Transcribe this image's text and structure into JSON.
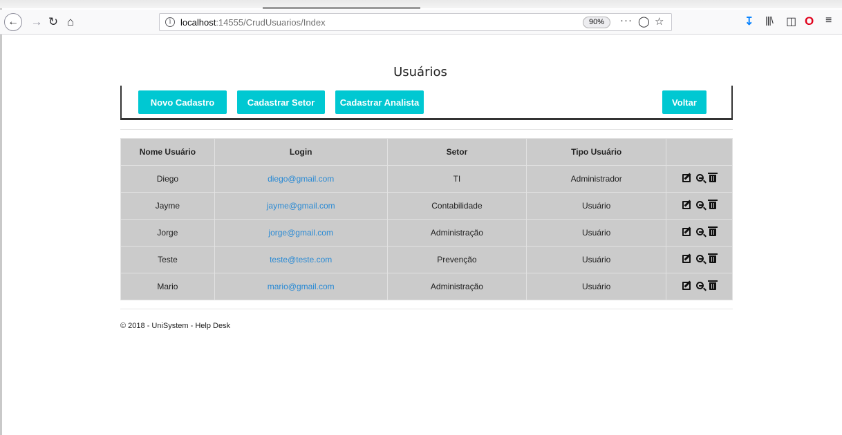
{
  "browser": {
    "url_host": "localhost",
    "url_rest": ":14555/CrudUsuarios/Index",
    "zoom": "90%",
    "info_glyph": "i",
    "more_glyph": "···"
  },
  "page": {
    "title": "Usuários",
    "buttons": {
      "new": "Novo Cadastro",
      "setor": "Cadastrar Setor",
      "analista": "Cadastrar Analista",
      "voltar": "Voltar"
    },
    "table": {
      "headers": [
        "Nome Usuário",
        "Login",
        "Setor",
        "Tipo Usuário",
        ""
      ],
      "rows": [
        {
          "nome": "Diego",
          "login": "diego@gmail.com",
          "setor": "TI",
          "tipo": "Administrador"
        },
        {
          "nome": "Jayme",
          "login": "jayme@gmail.com",
          "setor": "Contabilidade",
          "tipo": "Usuário"
        },
        {
          "nome": "Jorge",
          "login": "jorge@gmail.com",
          "setor": "Administração",
          "tipo": "Usuário"
        },
        {
          "nome": "Teste",
          "login": "teste@teste.com",
          "setor": "Prevenção",
          "tipo": "Usuário"
        },
        {
          "nome": "Mario",
          "login": "mario@gmail.com",
          "setor": "Administração",
          "tipo": "Usuário"
        }
      ],
      "row_actions": [
        "edit-icon",
        "zoom-icon",
        "trash-icon"
      ]
    },
    "footer": "© 2018 - UniSystem - Help Desk"
  },
  "colors": {
    "button_bg": "#00c8d2",
    "table_bg": "#cbcbcb",
    "link": "#2a8ad4"
  }
}
